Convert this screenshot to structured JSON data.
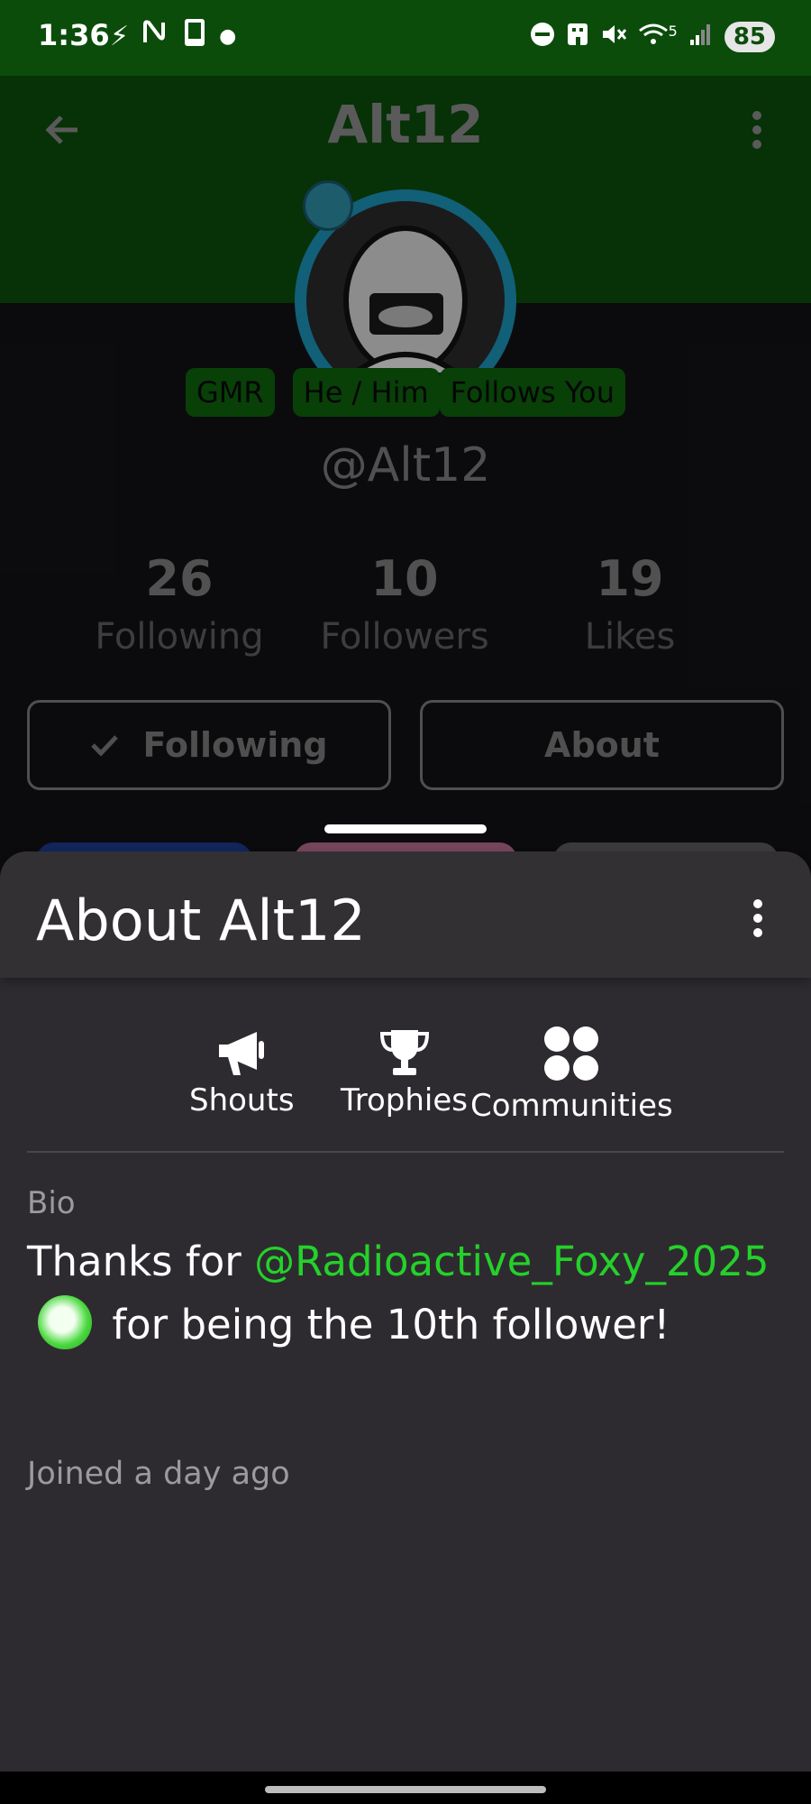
{
  "status_bar": {
    "time": "1:36",
    "left_icons": [
      "bolt-icon",
      "nfc-icon",
      "phone-icon",
      "dot-icon"
    ],
    "right_icons": [
      "do-not-disturb-icon",
      "building-icon",
      "mute-icon",
      "wifi-icon",
      "signal-icon"
    ],
    "wifi_label": "5",
    "battery": "85"
  },
  "profile": {
    "title": "Alt12",
    "badges": [
      "GMR",
      "He / Him",
      "Follows You"
    ],
    "handle": "@Alt12",
    "stats": [
      {
        "value": "26",
        "label": "Following"
      },
      {
        "value": "10",
        "label": "Followers"
      },
      {
        "value": "19",
        "label": "Likes"
      }
    ],
    "following_button": "Following",
    "about_button": "About"
  },
  "sheet": {
    "title": "About Alt12",
    "tabs": [
      {
        "label": "Shouts",
        "icon": "megaphone-icon"
      },
      {
        "label": "Trophies",
        "icon": "trophy-icon"
      },
      {
        "label": "Communities",
        "icon": "communities-icon"
      }
    ],
    "bio_label": "Bio",
    "bio_prefix": "Thanks for ",
    "bio_mention": "@Radioactive_Foxy_2025",
    "bio_suffix": "for being the 10th follower!",
    "joined": "Joined a day ago"
  },
  "colors": {
    "header_green": "#0b4c0b",
    "badge_green": "#0d630d",
    "mention_green": "#24d12a",
    "sheet_bg": "#2e2b30",
    "page_bg": "#121114"
  }
}
